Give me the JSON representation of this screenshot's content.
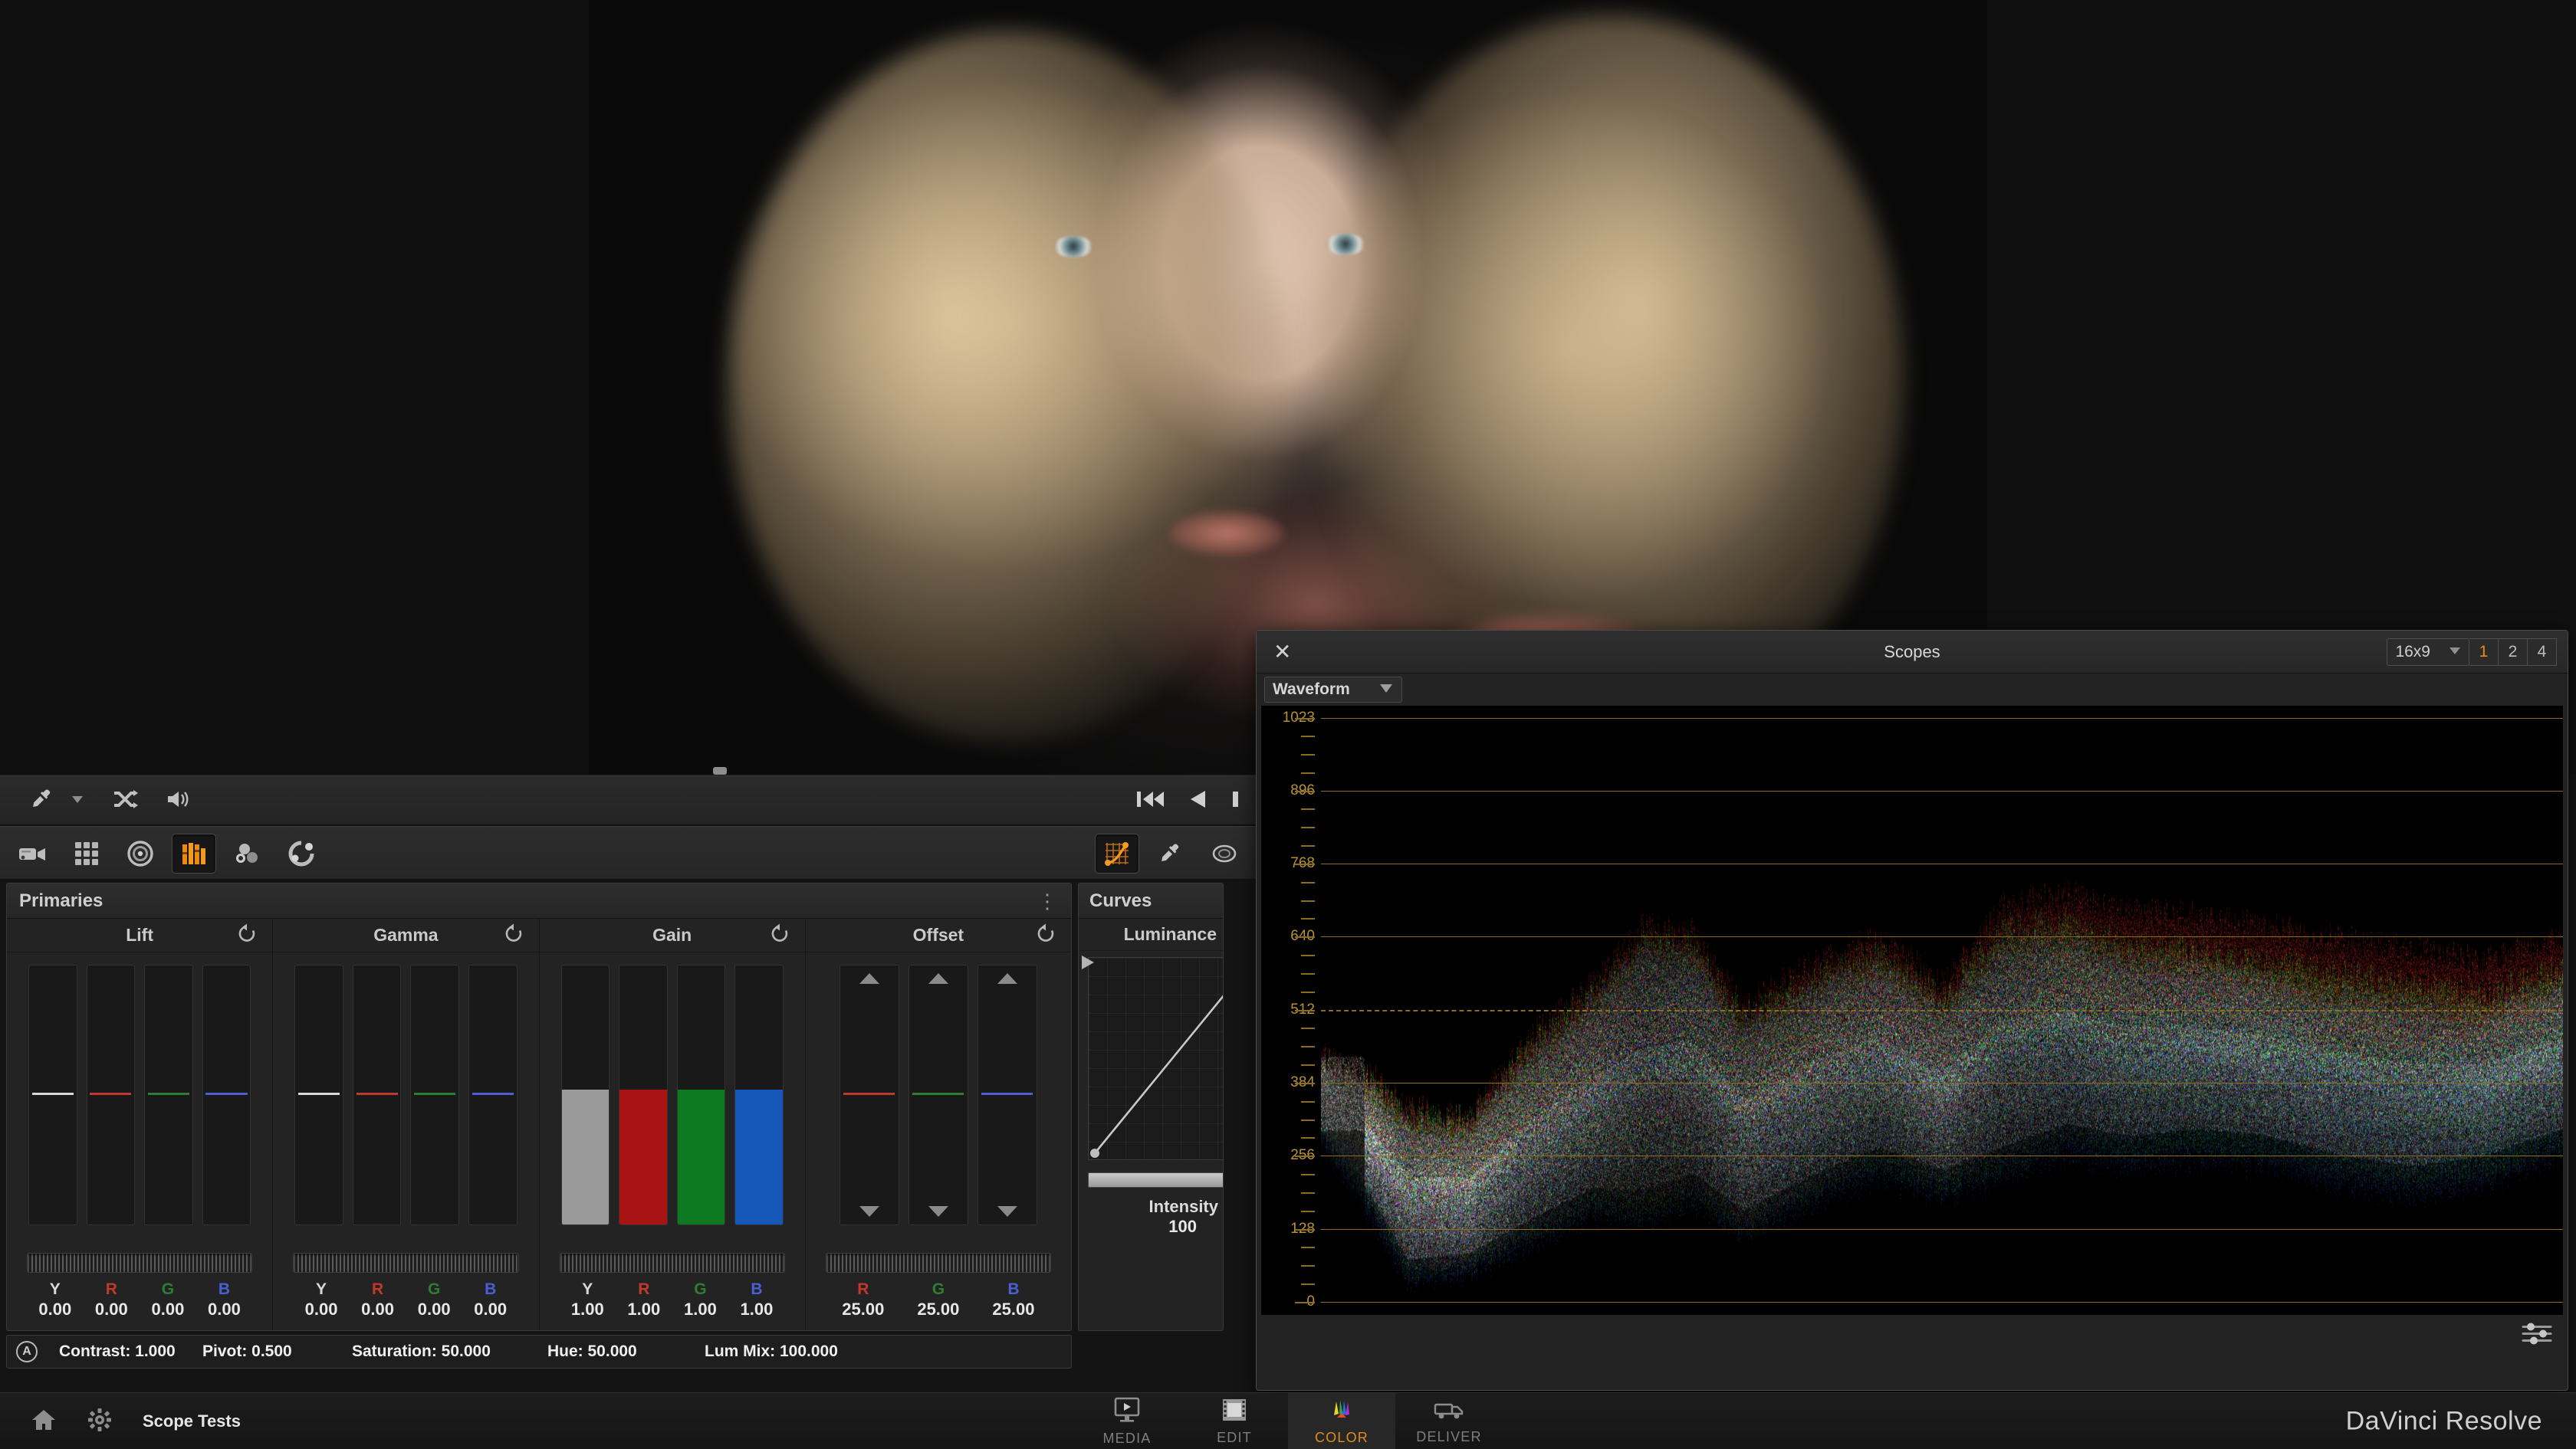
{
  "viewer": {
    "description": "color-graded close-up portrait of a blonde woman"
  },
  "transport": {
    "picker_icon": "eyedropper-icon",
    "picker_dropdown_icon": "chevron-down-icon",
    "shuffle_icon": "shuffle-icon",
    "audio_icon": "speaker-icon",
    "skip_start_icon": "skip-to-start-icon",
    "reverse_icon": "play-reverse-icon",
    "stop_icon": "stop-icon"
  },
  "palette_toolbar": {
    "left_buttons": [
      {
        "name": "camera-raw-icon",
        "active": false
      },
      {
        "name": "color-match-grid-icon",
        "active": false
      },
      {
        "name": "color-wheels-icon",
        "active": false
      },
      {
        "name": "primaries-bars-icon",
        "active": true
      },
      {
        "name": "log-wheels-icon",
        "active": false
      },
      {
        "name": "color-warper-icon",
        "active": false
      }
    ],
    "right_buttons": [
      {
        "name": "curves-icon",
        "active": true
      },
      {
        "name": "qualifier-eyedropper-icon",
        "active": false
      },
      {
        "name": "power-window-icon",
        "active": false
      }
    ]
  },
  "primaries": {
    "title": "Primaries",
    "menu_icon": "kebab-menu-icon",
    "reset_icon": "reset-circular-arrow-icon",
    "columns": [
      {
        "title": "Lift",
        "channels": [
          "Y",
          "R",
          "G",
          "B"
        ],
        "values": [
          "0.00",
          "0.00",
          "0.00",
          "0.00"
        ],
        "bar_positions": [
          0.5,
          0.5,
          0.5,
          0.5
        ],
        "style": "marker",
        "has_arrows": false
      },
      {
        "title": "Gamma",
        "channels": [
          "Y",
          "R",
          "G",
          "B"
        ],
        "values": [
          "0.00",
          "0.00",
          "0.00",
          "0.00"
        ],
        "bar_positions": [
          0.5,
          0.5,
          0.5,
          0.5
        ],
        "style": "marker",
        "has_arrows": false
      },
      {
        "title": "Gain",
        "channels": [
          "Y",
          "R",
          "G",
          "B"
        ],
        "values": [
          "1.00",
          "1.00",
          "1.00",
          "1.00"
        ],
        "bar_positions": [
          0.52,
          0.52,
          0.52,
          0.52
        ],
        "style": "fill",
        "has_arrows": false
      },
      {
        "title": "Offset",
        "channels": [
          "R",
          "G",
          "B"
        ],
        "values": [
          "25.00",
          "25.00",
          "25.00"
        ],
        "bar_positions": [
          0.5,
          0.5,
          0.5
        ],
        "style": "marker",
        "has_arrows": true
      }
    ],
    "channel_colors": {
      "Y": "#d8d8d8",
      "R": "#c0392b",
      "G": "#2e7d32",
      "B": "#4a5fd4"
    },
    "fill_colors": {
      "Y": "#9a9a9a",
      "R": "#a81414",
      "G": "#0d7a22",
      "B": "#1558ba"
    }
  },
  "curves": {
    "title": "Curves",
    "mode": "Luminance",
    "intensity_label": "Intensity",
    "intensity_value": "100"
  },
  "status_strip": {
    "auto_badge": "A",
    "items": [
      {
        "label": "Contrast:",
        "value": "1.000"
      },
      {
        "label": "Pivot:",
        "value": "0.500"
      },
      {
        "label": "Saturation:",
        "value": "50.000"
      },
      {
        "label": "Hue:",
        "value": "50.000"
      },
      {
        "label": "Lum Mix:",
        "value": "100.000"
      }
    ]
  },
  "scopes": {
    "title": "Scopes",
    "close_icon": "close-x-icon",
    "aspect_ratio": "16x9",
    "aspect_dropdown_icon": "chevron-down-icon",
    "layout_buttons": [
      {
        "label": "1",
        "active": true
      },
      {
        "label": "2",
        "active": false
      },
      {
        "label": "4",
        "active": false
      }
    ],
    "scope_type": "Waveform",
    "scope_dropdown_icon": "chevron-down-icon",
    "settings_icon": "sliders-icon",
    "scale_labels": [
      "1023",
      "896",
      "768",
      "640",
      "512",
      "384",
      "256",
      "128",
      "0"
    ],
    "scale_values": [
      1023,
      896,
      768,
      640,
      512,
      384,
      256,
      128,
      0
    ],
    "dashed_gridline_value": 512,
    "axis_color": "#b79234",
    "gridline_color": "#8a6d22"
  },
  "bottom_nav": {
    "home_icon": "home-icon",
    "settings_icon": "gear-icon",
    "project_name": "Scope Tests",
    "pages": [
      {
        "label": "MEDIA",
        "icon": "media-monitor-icon",
        "active": false
      },
      {
        "label": "EDIT",
        "icon": "filmstrip-icon",
        "active": false
      },
      {
        "label": "COLOR",
        "icon": "color-wheel-icon",
        "active": true
      },
      {
        "label": "DELIVER",
        "icon": "render-truck-icon",
        "active": false
      }
    ],
    "brand": "DaVinci Resolve",
    "accent_color": "#e08b1e"
  }
}
